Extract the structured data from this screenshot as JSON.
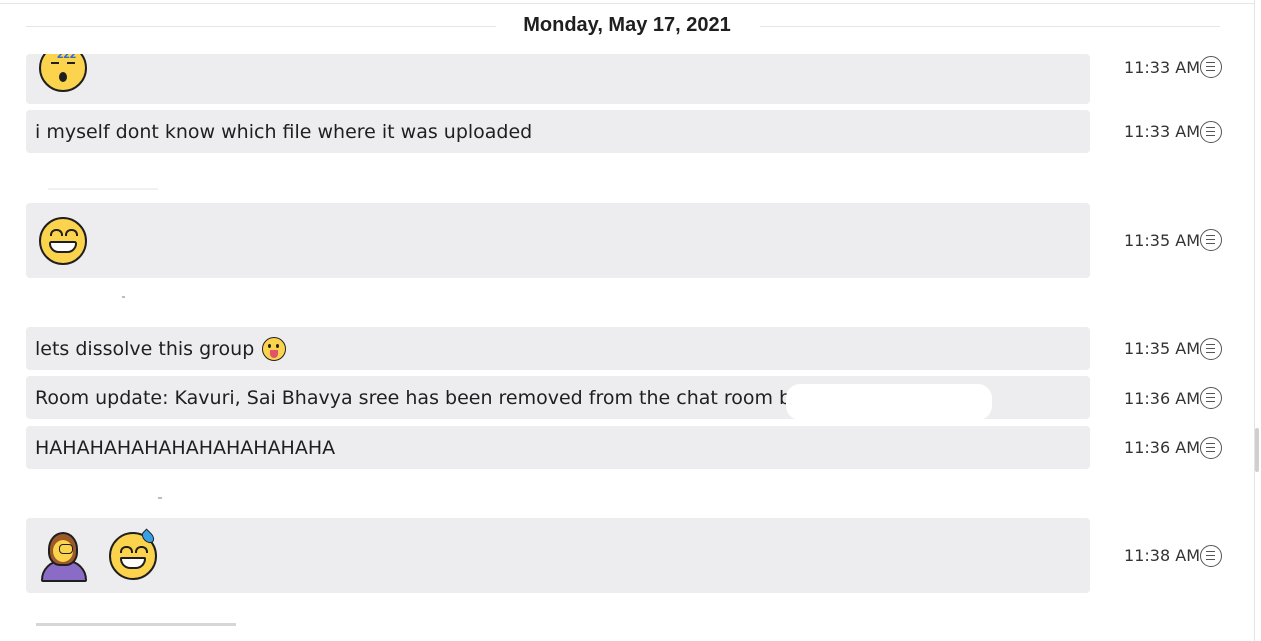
{
  "date_separator": "Monday, May 17, 2021",
  "messages": [
    {
      "text": "",
      "emoji": "sleeping-face",
      "time": "11:33 AM"
    },
    {
      "text": "i myself dont know which file where it was uploaded",
      "time": "11:33 AM"
    },
    {
      "text": "",
      "emoji": "grinning-face",
      "time": "11:35 AM"
    },
    {
      "text": "lets dissolve this group",
      "emoji": "tongue-face",
      "time": "11:35 AM"
    },
    {
      "text": "Room update: Kavuri, Sai Bhavya sree has been removed from the chat room b",
      "time": "11:36 AM"
    },
    {
      "text": "HAHAHAHAHAHAHAHAHAHAHA",
      "time": "11:36 AM"
    },
    {
      "text": "",
      "emoji": "facepalm-woman",
      "emoji2": "sweat-smile-face",
      "time": "11:38 AM"
    }
  ],
  "colors": {
    "bubble": "#ededf0",
    "emoji_yellow": "#fcd34d",
    "sweat_blue": "#39a0e6",
    "person_purple": "#8a6cc7"
  }
}
